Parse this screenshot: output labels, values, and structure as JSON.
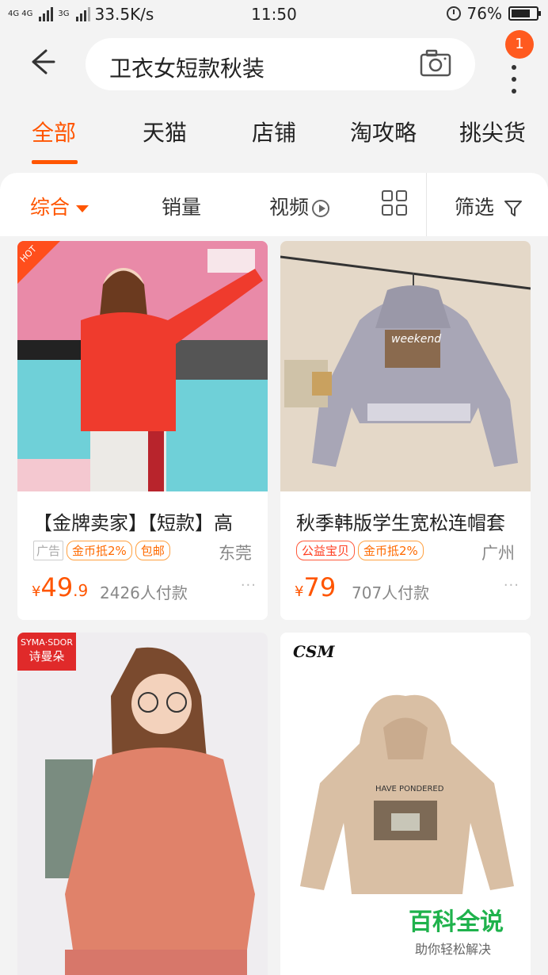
{
  "status": {
    "network": "4G 4G",
    "net3g": "3G",
    "speed": "33.5K/s",
    "time": "11:50",
    "battery": "76%",
    "battery_level": 0.76
  },
  "search": {
    "query": "卫衣女短款秋装",
    "badge": "1"
  },
  "tabs": [
    "全部",
    "天猫",
    "店铺",
    "淘攻略",
    "挑尖货"
  ],
  "sort": {
    "comprehensive": "综合",
    "sales": "销量",
    "video": "视频",
    "filter": "筛选"
  },
  "products": [
    {
      "title": "【金牌卖家】【短款】高",
      "tags": [
        "广告",
        "金币抵2%",
        "包邮"
      ],
      "location": "东莞",
      "price_symbol": "¥",
      "price_int": "49",
      "price_dec": ".9",
      "sales": "2426人付款",
      "badge": "HOT"
    },
    {
      "title": "秋季韩版学生宽松连帽套",
      "tags": [
        "公益宝贝",
        "金币抵2%"
      ],
      "location": "广州",
      "price_symbol": "¥",
      "price_int": "79",
      "price_dec": "",
      "sales": "707人付款"
    },
    {
      "brand_line1": "SYMA·SDOR",
      "brand_line2": "诗曼朵"
    },
    {
      "brand": "CSM"
    }
  ],
  "watermark": {
    "line1": "百科全说",
    "line2": "助你轻松解决"
  }
}
